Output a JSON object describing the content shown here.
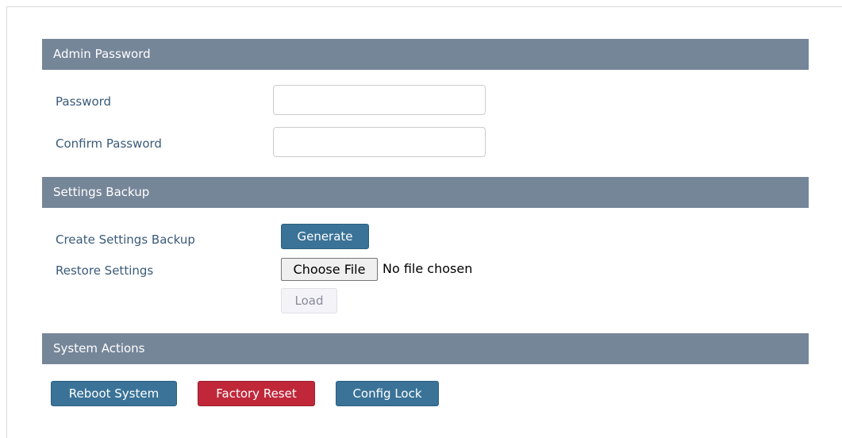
{
  "admin_password": {
    "header": "Admin Password",
    "password_label": "Password",
    "password_value": "",
    "confirm_label": "Confirm Password",
    "confirm_value": ""
  },
  "settings_backup": {
    "header": "Settings Backup",
    "create_label": "Create Settings Backup",
    "generate_button": "Generate",
    "restore_label": "Restore Settings",
    "choose_file_button": "Choose File",
    "file_status": "No file chosen",
    "load_button": "Load"
  },
  "system_actions": {
    "header": "System Actions",
    "reboot_button": "Reboot System",
    "factory_reset_button": "Factory Reset",
    "config_lock_button": "Config Lock"
  },
  "colors": {
    "section_header_bg": "#768699",
    "primary_button": "#3a7397",
    "danger_button": "#c0283a",
    "label_text": "#3a5a7a"
  }
}
